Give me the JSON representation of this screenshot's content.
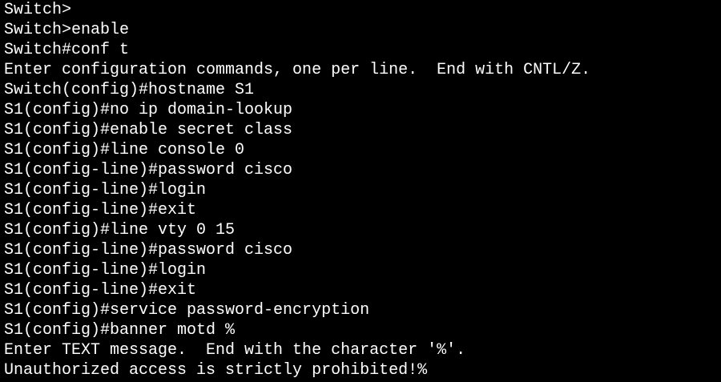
{
  "terminal": {
    "background": "#000000",
    "foreground": "#ffffff",
    "lines": [
      "Switch>",
      "Switch>enable",
      "Switch#conf t",
      "Enter configuration commands, one per line.  End with CNTL/Z.",
      "Switch(config)#hostname S1",
      "S1(config)#no ip domain-lookup",
      "S1(config)#enable secret class",
      "S1(config)#line console 0",
      "S1(config-line)#password cisco",
      "S1(config-line)#login",
      "S1(config-line)#exit",
      "S1(config)#line vty 0 15",
      "S1(config-line)#password cisco",
      "S1(config-line)#login",
      "S1(config-line)#exit",
      "S1(config)#service password-encryption",
      "S1(config)#banner motd %",
      "Enter TEXT message.  End with the character '%'.",
      "Unauthorized access is strictly prohibited!%"
    ]
  }
}
